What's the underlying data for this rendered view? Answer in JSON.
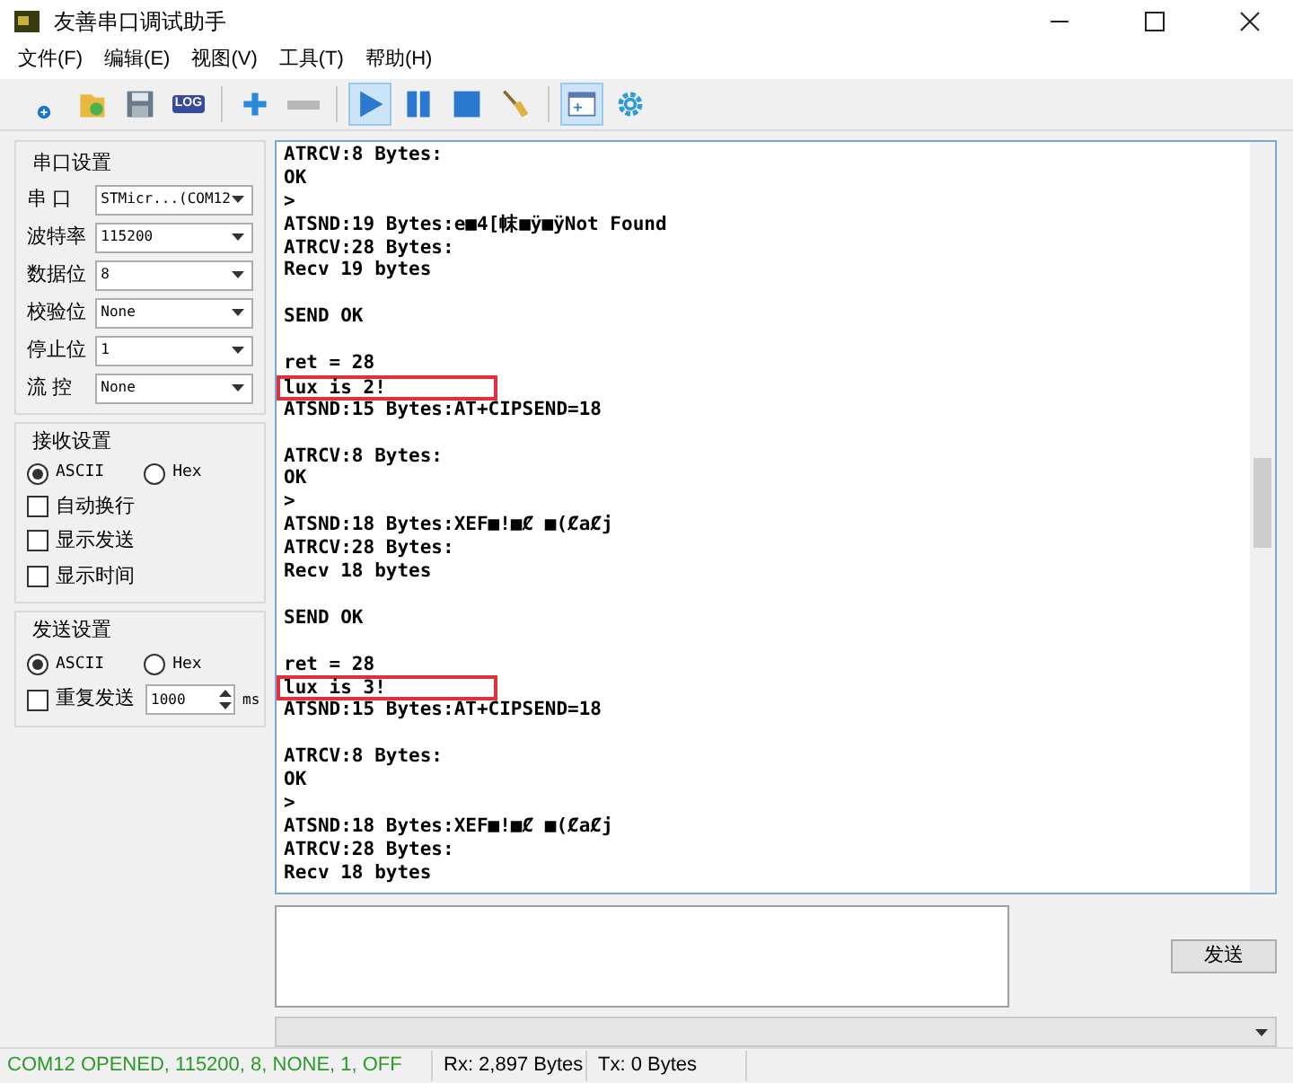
{
  "window": {
    "title": "友善串口调试助手"
  },
  "menu": [
    "文件(F)",
    "编辑(E)",
    "视图(V)",
    "工具(T)",
    "帮助(H)"
  ],
  "toolbar": [
    {
      "kind": "new",
      "active": false
    },
    {
      "kind": "open",
      "active": false
    },
    {
      "kind": "save",
      "active": false
    },
    {
      "kind": "log",
      "label": "LOG",
      "active": false
    },
    {
      "kind": "sep"
    },
    {
      "kind": "plus",
      "active": false
    },
    {
      "kind": "minus",
      "active": false
    },
    {
      "kind": "sep"
    },
    {
      "kind": "play",
      "active": true
    },
    {
      "kind": "pause",
      "active": false
    },
    {
      "kind": "stop",
      "active": false
    },
    {
      "kind": "broom",
      "active": false
    },
    {
      "kind": "sep"
    },
    {
      "kind": "window",
      "active": true
    },
    {
      "kind": "gear",
      "active": false
    }
  ],
  "serial_settings": {
    "title": "串口设置",
    "fields": [
      {
        "label": "串 口",
        "value": "STMicr...(COM12"
      },
      {
        "label": "波特率",
        "value": "115200"
      },
      {
        "label": "数据位",
        "value": "8"
      },
      {
        "label": "校验位",
        "value": "None"
      },
      {
        "label": "停止位",
        "value": "1"
      },
      {
        "label": "流 控",
        "value": "None"
      }
    ]
  },
  "receive_settings": {
    "title": "接收设置",
    "radios": [
      {
        "label": "ASCII",
        "selected": true
      },
      {
        "label": "Hex",
        "selected": false
      }
    ],
    "checkboxes": [
      {
        "label": "自动换行",
        "checked": false
      },
      {
        "label": "显示发送",
        "checked": false
      },
      {
        "label": "显示时间",
        "checked": false
      }
    ]
  },
  "send_settings": {
    "title": "发送设置",
    "radios": [
      {
        "label": "ASCII",
        "selected": true
      },
      {
        "label": "Hex",
        "selected": false
      }
    ],
    "repeat": {
      "label": "重复发送",
      "checked": false,
      "value": "1000",
      "unit": "ms"
    }
  },
  "log": [
    {
      "kind": "text",
      "text": "ATRCV:8 Bytes:",
      "highlighted": false
    },
    {
      "kind": "text",
      "text": "OK",
      "highlighted": false
    },
    {
      "kind": "text",
      "text": ">",
      "highlighted": false
    },
    {
      "kind": "text",
      "text": "ATSND:19 Bytes:e■4[帓■ÿ■ÿNot Found",
      "highlighted": false
    },
    {
      "kind": "text",
      "text": "ATRCV:28 Bytes:",
      "highlighted": false
    },
    {
      "kind": "text",
      "text": "Recv 19 bytes",
      "highlighted": false
    },
    {
      "kind": "blank"
    },
    {
      "kind": "text",
      "text": "SEND OK",
      "highlighted": false
    },
    {
      "kind": "blank"
    },
    {
      "kind": "text",
      "text": "ret = 28",
      "highlighted": false
    },
    {
      "kind": "text",
      "text": "lux is 2!",
      "highlighted": true
    },
    {
      "kind": "text",
      "text": "ATSND:15 Bytes:AT+CIPSEND=18",
      "highlighted": false
    },
    {
      "kind": "blank"
    },
    {
      "kind": "text",
      "text": "ATRCV:8 Bytes:",
      "highlighted": false
    },
    {
      "kind": "text",
      "text": "OK",
      "highlighted": false
    },
    {
      "kind": "text",
      "text": ">",
      "highlighted": false
    },
    {
      "kind": "text",
      "text": "ATSND:18 Bytes:XEF■!■Ȼ ■(ȻaȻj",
      "highlighted": false
    },
    {
      "kind": "text",
      "text": "ATRCV:28 Bytes:",
      "highlighted": false
    },
    {
      "kind": "text",
      "text": "Recv 18 bytes",
      "highlighted": false
    },
    {
      "kind": "blank"
    },
    {
      "kind": "text",
      "text": "SEND OK",
      "highlighted": false
    },
    {
      "kind": "blank"
    },
    {
      "kind": "text",
      "text": "ret = 28",
      "highlighted": false
    },
    {
      "kind": "text",
      "text": "lux is 3!",
      "highlighted": true
    },
    {
      "kind": "text",
      "text": "ATSND:15 Bytes:AT+CIPSEND=18",
      "highlighted": false
    },
    {
      "kind": "blank"
    },
    {
      "kind": "text",
      "text": "ATRCV:8 Bytes:",
      "highlighted": false
    },
    {
      "kind": "text",
      "text": "OK",
      "highlighted": false
    },
    {
      "kind": "text",
      "text": ">",
      "highlighted": false
    },
    {
      "kind": "text",
      "text": "ATSND:18 Bytes:XEF■!■Ȼ ■(ȻaȻj",
      "highlighted": false
    },
    {
      "kind": "text",
      "text": "ATRCV:28 Bytes:",
      "highlighted": false
    },
    {
      "kind": "text",
      "text": "Recv 18 bytes",
      "highlighted": false
    }
  ],
  "send_button": "发送",
  "status_bar": {
    "connection": "COM12 OPENED, 115200, 8, NONE, 1, OFF",
    "rx": "Rx: 2,897 Bytes",
    "tx": "Tx: 0 Bytes"
  }
}
